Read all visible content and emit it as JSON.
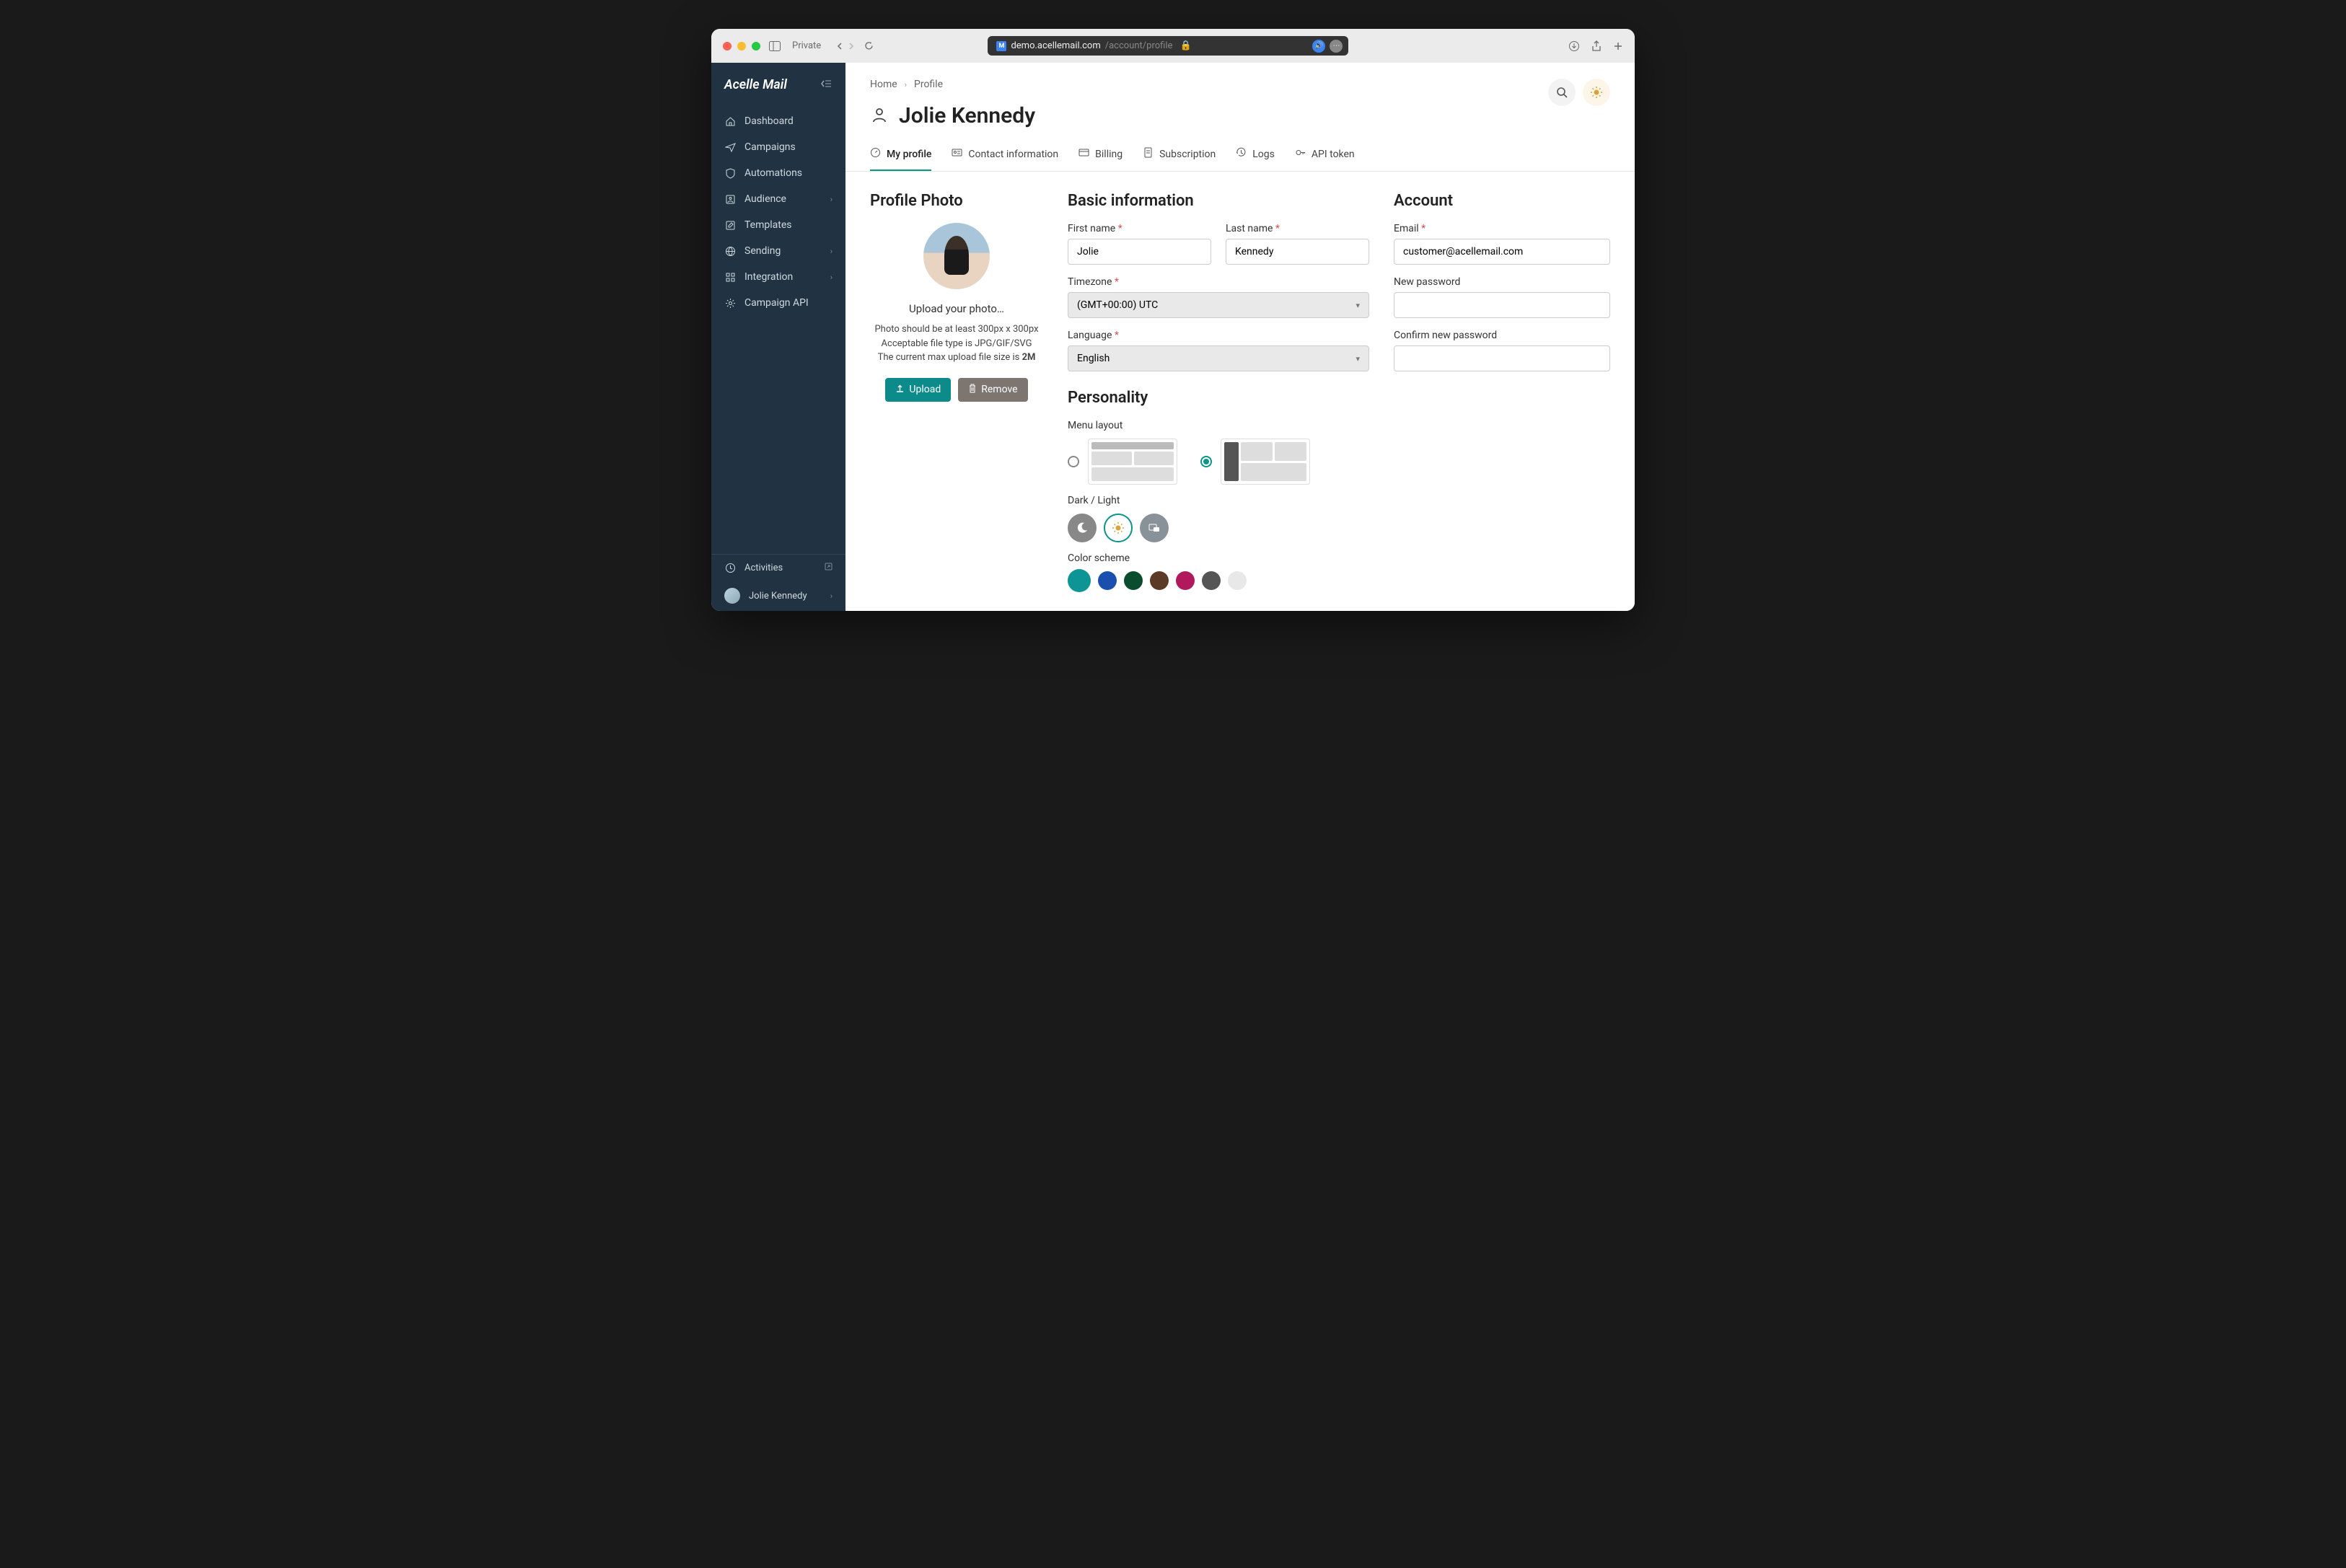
{
  "browser": {
    "private_label": "Private",
    "url_host": "demo.acellemail.com",
    "url_path": "/account/profile"
  },
  "sidebar": {
    "logo": "Acelle Mail",
    "nav": [
      {
        "label": "Dashboard",
        "expandable": false
      },
      {
        "label": "Campaigns",
        "expandable": false
      },
      {
        "label": "Automations",
        "expandable": false
      },
      {
        "label": "Audience",
        "expandable": true
      },
      {
        "label": "Templates",
        "expandable": false
      },
      {
        "label": "Sending",
        "expandable": true
      },
      {
        "label": "Integration",
        "expandable": true
      },
      {
        "label": "Campaign API",
        "expandable": false
      }
    ],
    "footer": {
      "activities": "Activities",
      "user": "Jolie Kennedy"
    }
  },
  "breadcrumb": {
    "home": "Home",
    "current": "Profile"
  },
  "page_title": "Jolie Kennedy",
  "tabs": [
    {
      "label": "My profile"
    },
    {
      "label": "Contact information"
    },
    {
      "label": "Billing"
    },
    {
      "label": "Subscription"
    },
    {
      "label": "Logs"
    },
    {
      "label": "API token"
    }
  ],
  "photo": {
    "title": "Profile Photo",
    "upload_title": "Upload your photo…",
    "hint1": "Photo should be at least 300px x 300px",
    "hint2": "Acceptable file type is JPG/GIF/SVG",
    "hint3": "The current max upload file size is ",
    "hint3_bold": "2M",
    "upload_btn": "Upload",
    "remove_btn": "Remove"
  },
  "basic": {
    "title": "Basic information",
    "first_name_label": "First name",
    "first_name_value": "Jolie",
    "last_name_label": "Last name",
    "last_name_value": "Kennedy",
    "timezone_label": "Timezone",
    "timezone_value": "(GMT+00:00) UTC",
    "language_label": "Language",
    "language_value": "English"
  },
  "account": {
    "title": "Account",
    "email_label": "Email",
    "email_value": "customer@acellemail.com",
    "new_pw_label": "New password",
    "confirm_pw_label": "Confirm new password"
  },
  "personality": {
    "title": "Personality",
    "menu_layout_label": "Menu layout",
    "theme_label": "Dark / Light",
    "color_label": "Color scheme",
    "colors": [
      "#0d9494",
      "#1a4fb0",
      "#0a4d2e",
      "#5c3a28",
      "#b01a5c",
      "#555555",
      "#e8e8e8"
    ]
  }
}
